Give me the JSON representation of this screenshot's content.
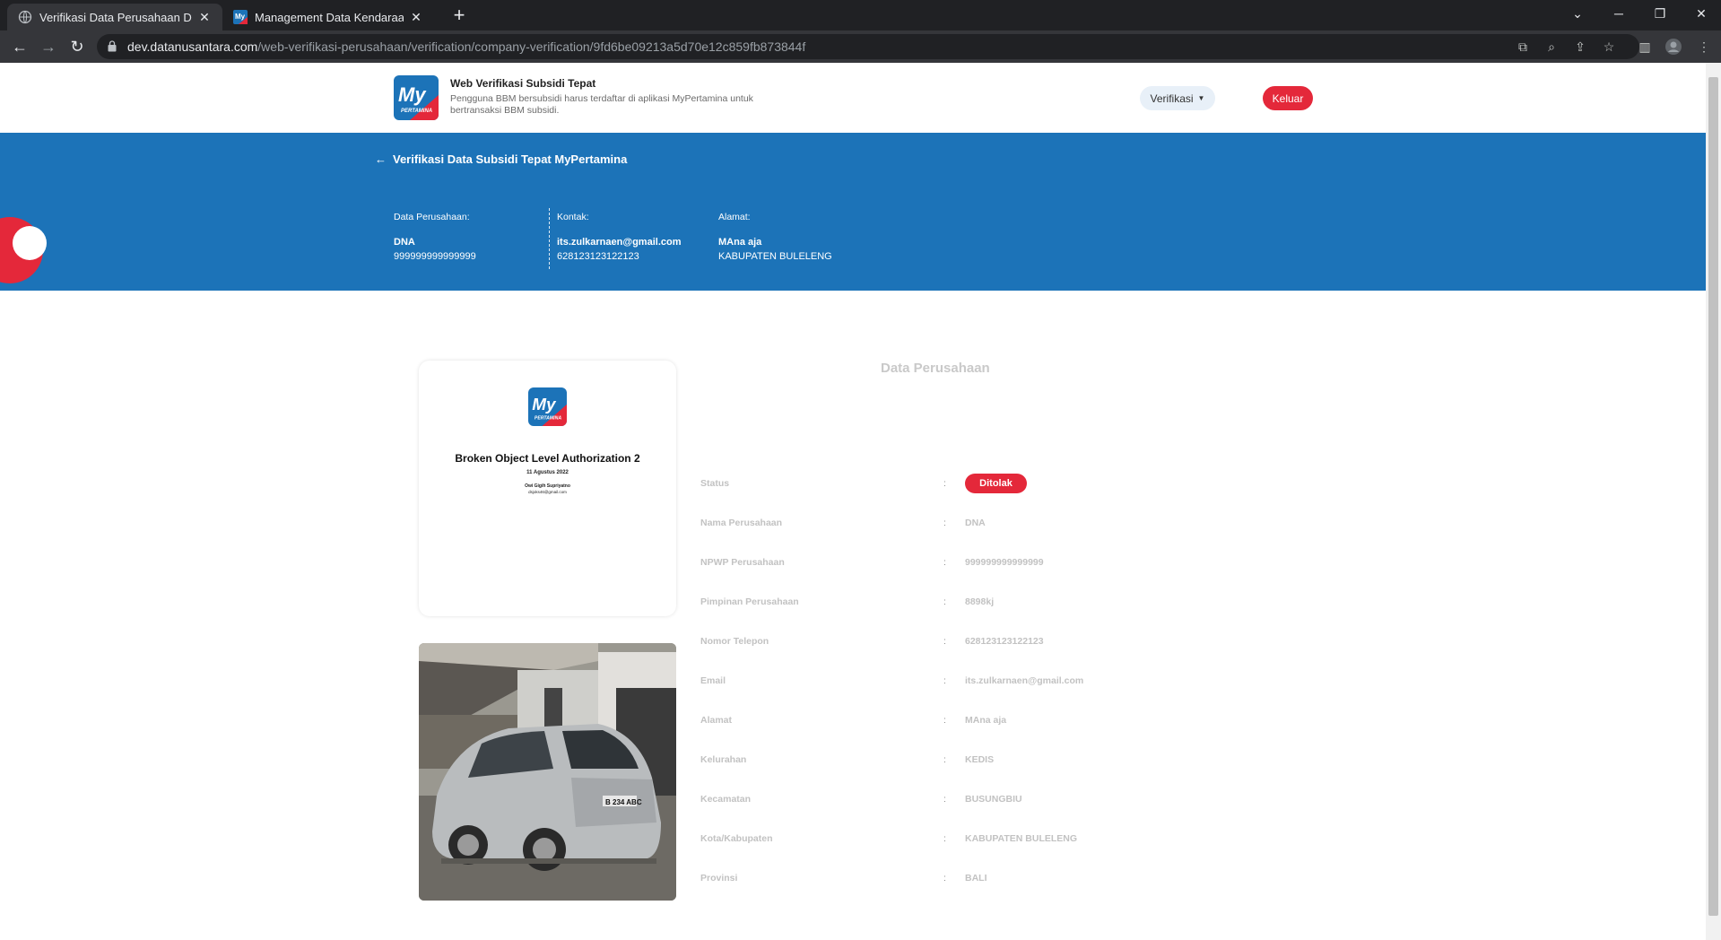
{
  "browser": {
    "tabs": [
      {
        "title": "Verifikasi Data Perusahaan DNA",
        "active": true
      },
      {
        "title": "Management Data Kendaraan Pr",
        "active": false
      }
    ],
    "url_host": "dev.datanusantara.com",
    "url_path": "/web-verifikasi-perusahaan/verification/company-verification/9fd6be09213a5d70e12c859fb873844f"
  },
  "header": {
    "brand_title": "Web Verifikasi Subsidi Tepat",
    "brand_subtitle": "Pengguna BBM bersubsidi harus terdaftar di aplikasi MyPertamina untuk bertransaksi BBM subsidi.",
    "logo_text_big": "My",
    "logo_text_small": "PERTAMINA",
    "verifikasi_label": "Verifikasi",
    "keluar_label": "Keluar"
  },
  "hero": {
    "back_arrow": "←",
    "title": "Verifikasi Data Subsidi Tepat MyPertamina",
    "company": {
      "label": "Data Perusahaan:",
      "name": "DNA",
      "id": "999999999999999"
    },
    "contact": {
      "label": "Kontak:",
      "email": "its.zulkarnaen@gmail.com",
      "phone": "628123123122123"
    },
    "address": {
      "label": "Alamat:",
      "line1": "MAna aja",
      "line2": "KABUPATEN BULELENG"
    }
  },
  "document": {
    "title": "Broken Object Level Authorization 2",
    "date": "11 Agustus 2022",
    "name": "Owi Gigih Supriyatno",
    "email": "dsjoks46@gmail.com"
  },
  "photo": {
    "plate": "B 234 ABC"
  },
  "details": {
    "section_title": "Data Perusahaan",
    "colon": ":",
    "status_label": "Status",
    "status_value": "Ditolak",
    "rows": [
      {
        "label": "Nama Perusahaan",
        "value": "DNA"
      },
      {
        "label": "NPWP Perusahaan",
        "value": "999999999999999"
      },
      {
        "label": "Pimpinan Perusahaan",
        "value": "8898kj"
      },
      {
        "label": "Nomor Telepon",
        "value": "628123123122123"
      },
      {
        "label": "Email",
        "value": "its.zulkarnaen@gmail.com"
      },
      {
        "label": "Alamat",
        "value": "MAna aja"
      },
      {
        "label": "Kelurahan",
        "value": "KEDIS"
      },
      {
        "label": "Kecamatan",
        "value": "BUSUNGBIU"
      },
      {
        "label": "Kota/Kabupaten",
        "value": "KABUPATEN BULELENG"
      },
      {
        "label": "Provinsi",
        "value": "BALI"
      }
    ]
  },
  "colors": {
    "primary_blue": "#1c73b8",
    "accent_red": "#e4283a"
  }
}
